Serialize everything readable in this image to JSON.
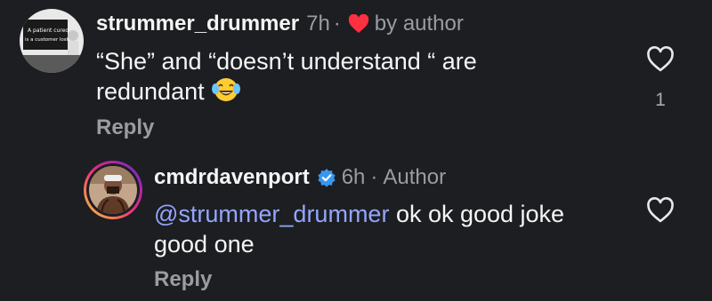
{
  "comments": [
    {
      "username": "strummer_drummer",
      "time": "7h",
      "separator": "·",
      "author_liked_label": "by author",
      "text": "“She” and “doesn’t understand “ are redundant",
      "emoji": "😂",
      "reply_label": "Reply",
      "like_count": "1",
      "avatar_text_line1": "A patient cured",
      "avatar_text_line2": "is a customer lost"
    },
    {
      "username": "cmdrdavenport",
      "time": "6h",
      "separator": "·",
      "author_label": "Author",
      "mention": "@strummer_drummer",
      "text": " ok ok good joke good one",
      "reply_label": "Reply"
    }
  ],
  "colors": {
    "background": "#1c1e21",
    "heart_red": "#ff3040",
    "verified_blue": "#3897f0",
    "mention": "#93a5ff",
    "muted": "#9a9ca1"
  }
}
